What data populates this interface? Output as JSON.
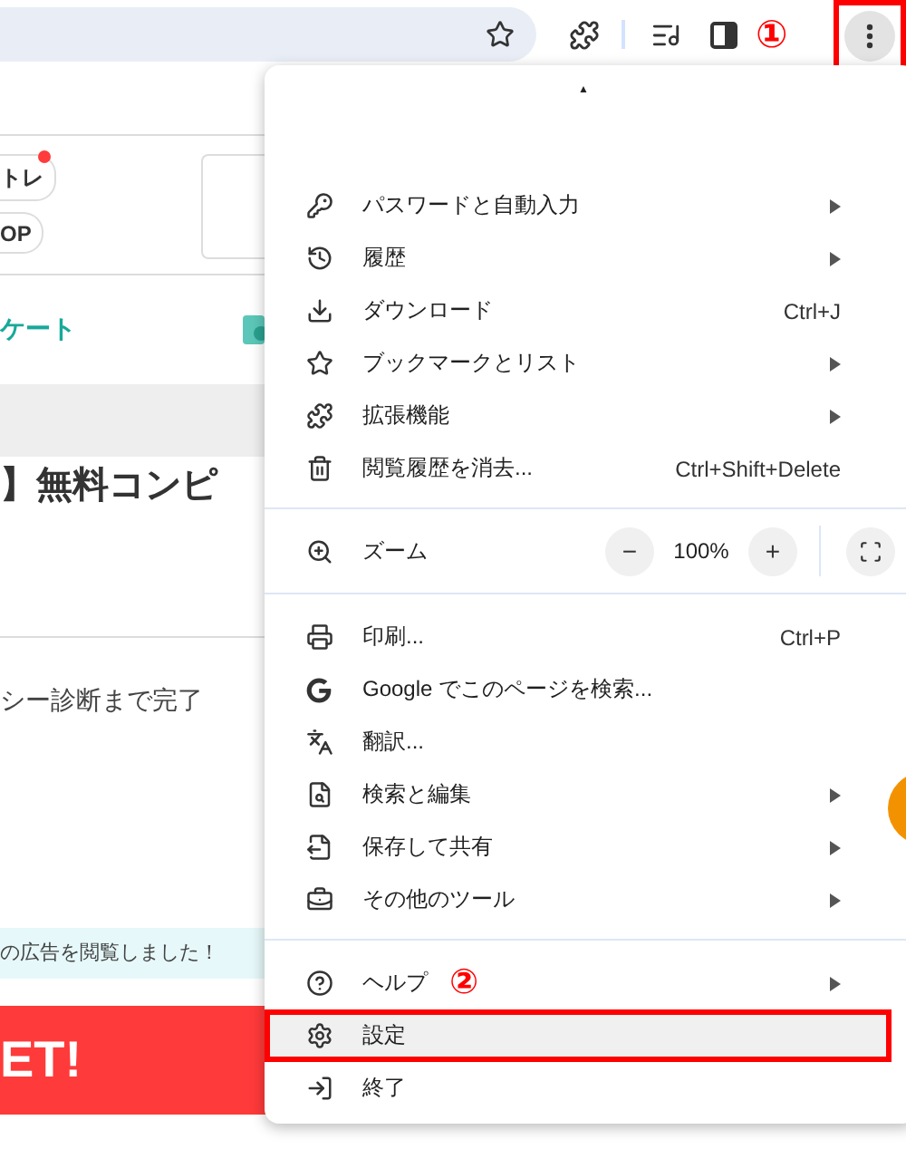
{
  "toolbar": {
    "marker": "①",
    "menu_button_highlighted": true
  },
  "page": {
    "pills": [
      {
        "label": "トレ",
        "dot": true
      },
      {
        "label": "OP",
        "dot": false
      }
    ],
    "link": "ケート",
    "heading": "】無料コンピ",
    "progress": "シー診断まで完了",
    "notice": "の広告を閲覧しました！",
    "banner": "ET!"
  },
  "menu": {
    "caret": "▲",
    "sections": [
      [
        {
          "kind": "item",
          "label": "パスワードと自動入力",
          "submenu": true,
          "highlighted": false
        },
        {
          "kind": "item",
          "label": "履歴",
          "submenu": true,
          "highlighted": false
        },
        {
          "kind": "item",
          "label": "ダウンロード",
          "shortcut": "Ctrl+J",
          "submenu": false,
          "highlighted": false
        },
        {
          "kind": "item",
          "label": "ブックマークとリスト",
          "submenu": true,
          "highlighted": false
        },
        {
          "kind": "item",
          "label": "拡張機能",
          "submenu": true,
          "highlighted": false
        },
        {
          "kind": "item",
          "label": "閲覧履歴を消去...",
          "shortcut": "Ctrl+Shift+Delete",
          "submenu": false,
          "highlighted": false
        }
      ],
      [
        {
          "kind": "zoom",
          "label": "ズーム",
          "minus": "−",
          "value": "100%",
          "plus": "+"
        }
      ],
      [
        {
          "kind": "item",
          "label": "印刷...",
          "shortcut": "Ctrl+P",
          "submenu": false,
          "highlighted": false
        },
        {
          "kind": "item",
          "label": "Google でこのページを検索...",
          "submenu": false,
          "highlighted": false
        },
        {
          "kind": "item",
          "label": "翻訳...",
          "submenu": false,
          "highlighted": false
        },
        {
          "kind": "item",
          "label": "検索と編集",
          "submenu": true,
          "highlighted": false
        },
        {
          "kind": "item",
          "label": "保存して共有",
          "submenu": true,
          "highlighted": false
        },
        {
          "kind": "item",
          "label": "その他のツール",
          "submenu": true,
          "highlighted": false
        }
      ],
      [
        {
          "kind": "item",
          "label": "ヘルプ",
          "submenu": true,
          "highlighted": false,
          "marker": "②"
        },
        {
          "kind": "item",
          "label": "設定",
          "submenu": false,
          "highlighted": true
        },
        {
          "kind": "item",
          "label": "終了",
          "submenu": false,
          "highlighted": false
        }
      ]
    ]
  }
}
